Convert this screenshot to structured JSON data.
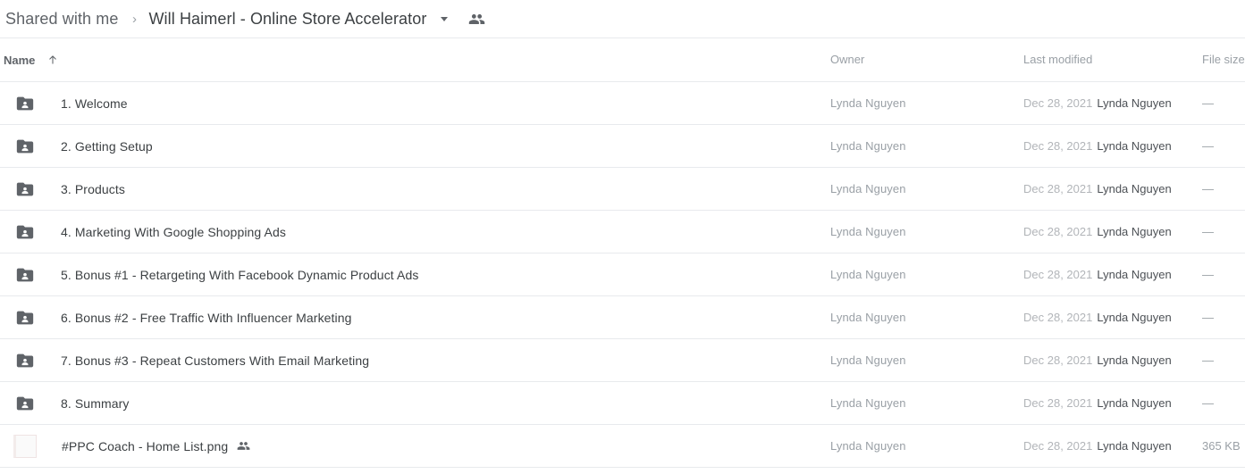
{
  "breadcrumb": {
    "root_label": "Shared with me",
    "separator": "›",
    "current_label": "Will Haimerl - Online Store Accelerator",
    "caret_icon": "chevron-down-icon",
    "share_icon": "people-shared-icon"
  },
  "table": {
    "headers": {
      "name": "Name",
      "sort_icon": "sort-ascending-arrow-icon",
      "owner": "Owner",
      "last_modified": "Last modified",
      "file_size": "File size"
    },
    "rows": [
      {
        "icon": "shared-folder-icon",
        "kind": "folder",
        "name": "1. Welcome",
        "shared": false,
        "owner": "Lynda Nguyen",
        "modified_date": "Dec 28, 2021",
        "modified_by": "Lynda Nguyen",
        "size": "—"
      },
      {
        "icon": "shared-folder-icon",
        "kind": "folder",
        "name": "2. Getting Setup",
        "shared": false,
        "owner": "Lynda Nguyen",
        "modified_date": "Dec 28, 2021",
        "modified_by": "Lynda Nguyen",
        "size": "—"
      },
      {
        "icon": "shared-folder-icon",
        "kind": "folder",
        "name": "3. Products",
        "shared": false,
        "owner": "Lynda Nguyen",
        "modified_date": "Dec 28, 2021",
        "modified_by": "Lynda Nguyen",
        "size": "—"
      },
      {
        "icon": "shared-folder-icon",
        "kind": "folder",
        "name": "4. Marketing With Google Shopping Ads",
        "shared": false,
        "owner": "Lynda Nguyen",
        "modified_date": "Dec 28, 2021",
        "modified_by": "Lynda Nguyen",
        "size": "—"
      },
      {
        "icon": "shared-folder-icon",
        "kind": "folder",
        "name": "5. Bonus #1 - Retargeting With Facebook Dynamic Product Ads",
        "shared": false,
        "owner": "Lynda Nguyen",
        "modified_date": "Dec 28, 2021",
        "modified_by": "Lynda Nguyen",
        "size": "—"
      },
      {
        "icon": "shared-folder-icon",
        "kind": "folder",
        "name": "6. Bonus #2 - Free Traffic With Influencer Marketing",
        "shared": false,
        "owner": "Lynda Nguyen",
        "modified_date": "Dec 28, 2021",
        "modified_by": "Lynda Nguyen",
        "size": "—"
      },
      {
        "icon": "shared-folder-icon",
        "kind": "folder",
        "name": "7. Bonus #3 - Repeat Customers With Email Marketing",
        "shared": false,
        "owner": "Lynda Nguyen",
        "modified_date": "Dec 28, 2021",
        "modified_by": "Lynda Nguyen",
        "size": "—"
      },
      {
        "icon": "shared-folder-icon",
        "kind": "folder",
        "name": "8. Summary",
        "shared": false,
        "owner": "Lynda Nguyen",
        "modified_date": "Dec 28, 2021",
        "modified_by": "Lynda Nguyen",
        "size": "—"
      },
      {
        "icon": "image-thumbnail",
        "kind": "file",
        "name": "#PPC Coach - Home List.png",
        "shared": true,
        "owner": "Lynda Nguyen",
        "modified_date": "Dec 28, 2021",
        "modified_by": "Lynda Nguyen",
        "size": "365 KB"
      }
    ]
  },
  "colors": {
    "folder_icon": "#5f6368",
    "divider": "#e8eaed",
    "text_primary": "#3c4043",
    "text_secondary": "#9aa0a6",
    "background": "#ffffff"
  }
}
